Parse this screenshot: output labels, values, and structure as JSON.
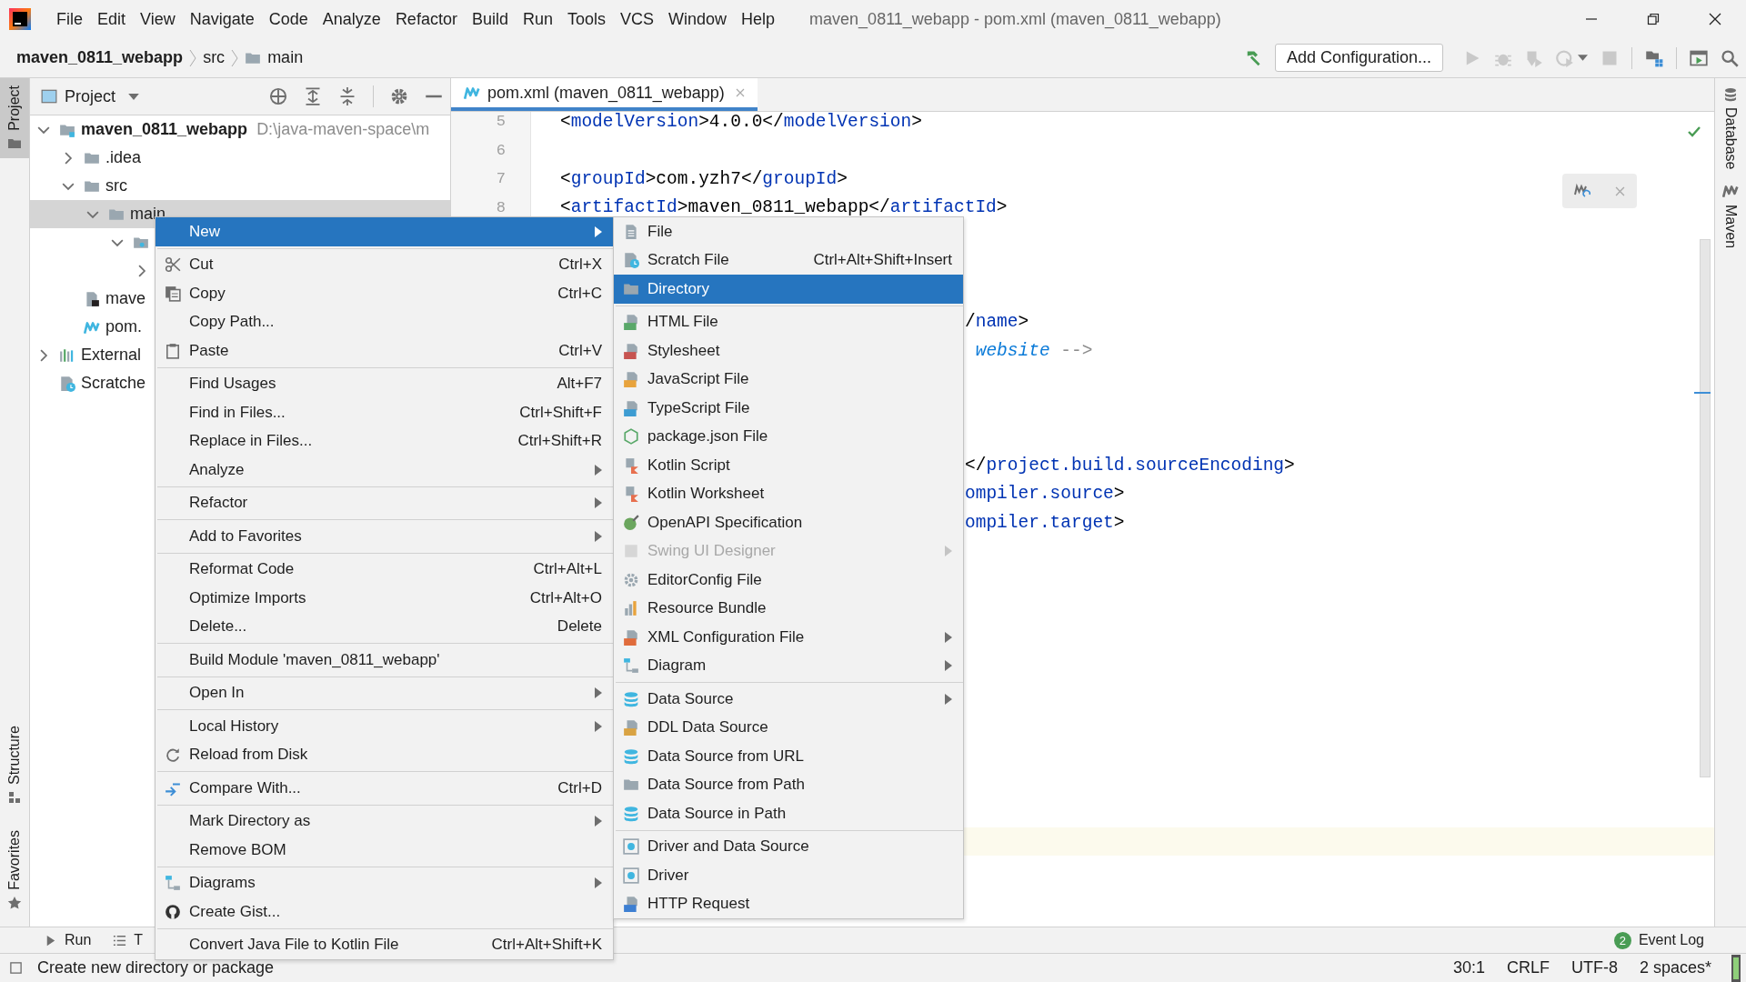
{
  "window": {
    "title": "maven_0811_webapp - pom.xml (maven_0811_webapp)"
  },
  "menu_bar": [
    "File",
    "Edit",
    "View",
    "Navigate",
    "Code",
    "Analyze",
    "Refactor",
    "Build",
    "Run",
    "Tools",
    "VCS",
    "Window",
    "Help"
  ],
  "breadcrumbs": [
    "maven_0811_webapp",
    "src",
    "main"
  ],
  "toolbar": {
    "run_configuration": "Add Configuration..."
  },
  "left_strip": [
    {
      "label": "Project",
      "selected": true
    },
    {
      "label": "Structure",
      "selected": false
    },
    {
      "label": "Favorites",
      "selected": false
    }
  ],
  "right_strip": [
    {
      "label": "Database"
    },
    {
      "label": "Maven"
    }
  ],
  "project_panel": {
    "title": "Project",
    "tree": [
      {
        "label": "maven_0811_webapp",
        "path": "D:\\java-maven-space\\m",
        "kind": "module",
        "expanded": true,
        "selected": false,
        "children": [
          {
            "label": ".idea",
            "kind": "folder",
            "expanded": false,
            "selected": false
          },
          {
            "label": "src",
            "kind": "folder",
            "expanded": true,
            "selected": false,
            "children": [
              {
                "label": "main",
                "kind": "folder",
                "expanded": true,
                "selected": true,
                "children": [
                  {
                    "kind": "source_folder",
                    "expanded": true,
                    "selected": false,
                    "children": [
                      {
                        "expanded": false,
                        "selected": false
                      }
                    ]
                  }
                ]
              }
            ]
          },
          {
            "label": "mave",
            "kind": "iml",
            "selected": false
          },
          {
            "label": "pom.",
            "kind": "maven",
            "selected": false
          }
        ]
      },
      {
        "label": "External",
        "kind": "library",
        "expanded": false,
        "selected": false
      },
      {
        "label": "Scratche",
        "kind": "scratches",
        "selected": false
      }
    ]
  },
  "editor": {
    "tab": {
      "label": "pom.xml (maven_0811_webapp)"
    },
    "current_line_highlight": true,
    "lines": [
      {
        "number": "5",
        "parts": [
          {
            "kind": "bracket",
            "text": "<"
          },
          {
            "kind": "tag",
            "text": "modelVersion"
          },
          {
            "kind": "bracket",
            "text": ">4.0.0</"
          },
          {
            "kind": "tag",
            "text": "modelVersion"
          },
          {
            "kind": "bracket",
            "text": ">"
          }
        ]
      },
      {
        "number": "6"
      },
      {
        "number": "7",
        "parts": [
          {
            "kind": "bracket",
            "text": "<"
          },
          {
            "kind": "tag",
            "text": "groupId"
          },
          {
            "kind": "bracket",
            "text": ">com.yzh7</"
          },
          {
            "kind": "tag",
            "text": "groupId"
          },
          {
            "kind": "bracket",
            "text": ">"
          }
        ]
      },
      {
        "number": "8",
        "parts": [
          {
            "kind": "bracket",
            "text": "<"
          },
          {
            "kind": "tag",
            "text": "artifactId"
          },
          {
            "kind": "bracket",
            "text": ">maven_0811_webapp</"
          },
          {
            "kind": "tag",
            "text": "artifactId"
          },
          {
            "kind": "bracket",
            "text": ">"
          }
        ]
      },
      {
        "clipped": true
      },
      {
        "clipped": true
      },
      {
        "clipped": true
      },
      {
        "clipped": true,
        "parts": [
          {
            "kind": "bracket",
            "text": "/"
          },
          {
            "kind": "tag",
            "text": "name"
          },
          {
            "kind": "bracket",
            "text": ">"
          }
        ]
      },
      {
        "clipped": true,
        "parts": [
          {
            "kind": "link",
            "text": " website"
          },
          {
            "kind": "comment",
            "text": " -->"
          }
        ]
      },
      {
        "clipped": true
      },
      {
        "clipped": true
      },
      {
        "clipped": true
      },
      {
        "clipped": true,
        "parts": [
          {
            "kind": "bracket",
            "text": "</"
          },
          {
            "kind": "tag",
            "text": "project.build.sourceEncoding"
          },
          {
            "kind": "bracket",
            "text": ">"
          }
        ]
      },
      {
        "clipped": true,
        "parts": [
          {
            "kind": "tag",
            "text": "ompiler.source"
          },
          {
            "kind": "bracket",
            "text": ">"
          }
        ]
      },
      {
        "clipped": true,
        "parts": [
          {
            "kind": "tag",
            "text": "ompiler.target"
          },
          {
            "kind": "bracket",
            "text": ">"
          }
        ]
      }
    ]
  },
  "context_menu": {
    "items": [
      {
        "label": "New",
        "submenu": true,
        "selected": true,
        "separator_after": true
      },
      {
        "label": "Cut",
        "shortcut": "Ctrl+X",
        "submenu": false,
        "selected": false
      },
      {
        "label": "Copy",
        "shortcut": "Ctrl+C",
        "submenu": false,
        "selected": false
      },
      {
        "label": "Copy Path...",
        "submenu": false,
        "selected": false
      },
      {
        "label": "Paste",
        "shortcut": "Ctrl+V",
        "submenu": false,
        "selected": false,
        "separator_after": true
      },
      {
        "label": "Find Usages",
        "shortcut": "Alt+F7",
        "submenu": false,
        "selected": false
      },
      {
        "label": "Find in Files...",
        "shortcut": "Ctrl+Shift+F",
        "submenu": false,
        "selected": false
      },
      {
        "label": "Replace in Files...",
        "shortcut": "Ctrl+Shift+R",
        "submenu": false,
        "selected": false
      },
      {
        "label": "Analyze",
        "submenu": true,
        "selected": false,
        "separator_after": true
      },
      {
        "label": "Refactor",
        "submenu": true,
        "selected": false,
        "separator_after": true
      },
      {
        "label": "Add to Favorites",
        "submenu": true,
        "selected": false,
        "separator_after": true
      },
      {
        "label": "Reformat Code",
        "shortcut": "Ctrl+Alt+L",
        "submenu": false,
        "selected": false
      },
      {
        "label": "Optimize Imports",
        "shortcut": "Ctrl+Alt+O",
        "submenu": false,
        "selected": false
      },
      {
        "label": "Delete...",
        "shortcut": "Delete",
        "submenu": false,
        "selected": false,
        "separator_after": true
      },
      {
        "label": "Build Module 'maven_0811_webapp'",
        "submenu": false,
        "selected": false,
        "separator_after": true
      },
      {
        "label": "Open In",
        "submenu": true,
        "selected": false,
        "separator_after": true
      },
      {
        "label": "Local History",
        "submenu": true,
        "selected": false
      },
      {
        "label": "Reload from Disk",
        "submenu": false,
        "selected": false,
        "separator_after": true
      },
      {
        "label": "Compare With...",
        "shortcut": "Ctrl+D",
        "submenu": false,
        "selected": false,
        "separator_after": true
      },
      {
        "label": "Mark Directory as",
        "submenu": true,
        "selected": false
      },
      {
        "label": "Remove BOM",
        "submenu": false,
        "selected": false,
        "separator_after": true
      },
      {
        "label": "Diagrams",
        "submenu": true,
        "selected": false
      },
      {
        "label": "Create Gist...",
        "submenu": false,
        "selected": false,
        "separator_after": true
      },
      {
        "label": "Convert Java File to Kotlin File",
        "shortcut": "Ctrl+Alt+Shift+K",
        "submenu": false,
        "selected": false
      }
    ]
  },
  "submenu": {
    "items": [
      {
        "label": "File",
        "submenu": false,
        "selected": false,
        "disabled": false
      },
      {
        "label": "Scratch File",
        "shortcut": "Ctrl+Alt+Shift+Insert",
        "submenu": false,
        "selected": false,
        "disabled": false
      },
      {
        "label": "Directory",
        "submenu": false,
        "selected": true,
        "disabled": false,
        "separator_after": true
      },
      {
        "label": "HTML File",
        "submenu": false,
        "selected": false,
        "disabled": false
      },
      {
        "label": "Stylesheet",
        "submenu": false,
        "selected": false,
        "disabled": false
      },
      {
        "label": "JavaScript File",
        "submenu": false,
        "selected": false,
        "disabled": false
      },
      {
        "label": "TypeScript File",
        "submenu": false,
        "selected": false,
        "disabled": false
      },
      {
        "label": "package.json File",
        "submenu": false,
        "selected": false,
        "disabled": false
      },
      {
        "label": "Kotlin Script",
        "submenu": false,
        "selected": false,
        "disabled": false
      },
      {
        "label": "Kotlin Worksheet",
        "submenu": false,
        "selected": false,
        "disabled": false
      },
      {
        "label": "OpenAPI Specification",
        "submenu": false,
        "selected": false,
        "disabled": false
      },
      {
        "label": "Swing UI Designer",
        "submenu": true,
        "selected": false,
        "disabled": true
      },
      {
        "label": "EditorConfig File",
        "submenu": false,
        "selected": false,
        "disabled": false
      },
      {
        "label": "Resource Bundle",
        "submenu": false,
        "selected": false,
        "disabled": false
      },
      {
        "label": "XML Configuration File",
        "submenu": true,
        "selected": false,
        "disabled": false
      },
      {
        "label": "Diagram",
        "submenu": true,
        "selected": false,
        "disabled": false,
        "separator_after": true
      },
      {
        "label": "Data Source",
        "submenu": true,
        "selected": false,
        "disabled": false
      },
      {
        "label": "DDL Data Source",
        "submenu": false,
        "selected": false,
        "disabled": false
      },
      {
        "label": "Data Source from URL",
        "submenu": false,
        "selected": false,
        "disabled": false
      },
      {
        "label": "Data Source from Path",
        "submenu": false,
        "selected": false,
        "disabled": false
      },
      {
        "label": "Data Source in Path",
        "submenu": false,
        "selected": false,
        "disabled": false,
        "separator_after": true
      },
      {
        "label": "Driver and Data Source",
        "submenu": false,
        "selected": false,
        "disabled": false
      },
      {
        "label": "Driver",
        "submenu": false,
        "selected": false,
        "disabled": false
      },
      {
        "label": "HTTP Request",
        "submenu": false,
        "selected": false,
        "disabled": false
      }
    ]
  },
  "bottom_bar": {
    "tools": [
      "Run",
      "T"
    ],
    "event_log": {
      "label": "Event Log",
      "count": "2"
    }
  },
  "status_bar": {
    "message": "Create new directory or package",
    "position": "30:1",
    "line_separator": "CRLF",
    "encoding": "UTF-8",
    "indent": "2 spaces*"
  }
}
